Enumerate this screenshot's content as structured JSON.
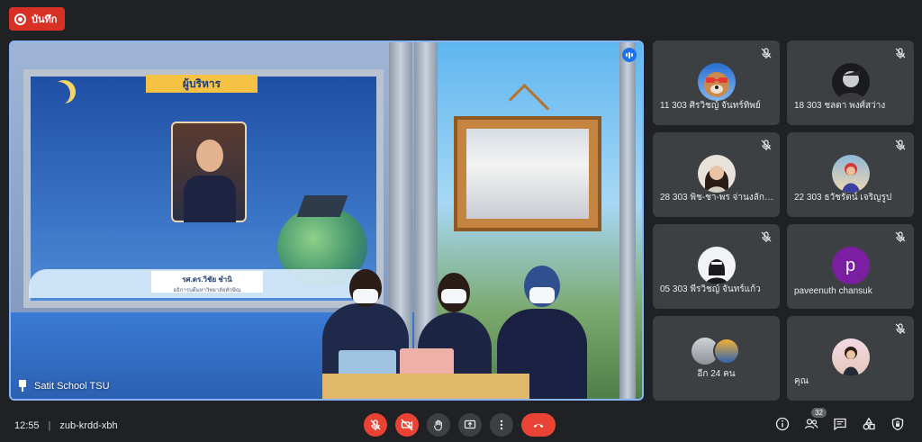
{
  "recording": {
    "label": "บันทึก"
  },
  "main_video": {
    "presenter_label": "Satit School TSU",
    "slide_banner": "ผู้บริหาร",
    "slide_name": "รศ.ดร.วิชัย ชำนิ",
    "slide_role": "อธิการบดีมหาวิทยาลัยทักษิณ"
  },
  "participants": [
    {
      "name": "11 303 ศิรวิชญ์ จันทร์ทิพย์",
      "avatar": "dog-sunglasses-avatar"
    },
    {
      "name": "18 303 ชลดา พงศ์สว่าง",
      "avatar": "character-avatar"
    },
    {
      "name": "28 303 พิช-ชา-พร จ่านงลักษ...",
      "avatar": "girl-photo-avatar"
    },
    {
      "name": "22 303 ธวัชรัตน์ เจริญรูป",
      "avatar": "person-photo-avatar"
    },
    {
      "name": "05 303 พีรวิชญ์ จันทร์แก้ว",
      "avatar": "masked-avatar"
    },
    {
      "name": "paveenuth chansuk",
      "avatar_letter": "p"
    },
    {
      "name": "อีก 24 คน",
      "avatar": "group-avatars"
    },
    {
      "name": "คุณ",
      "avatar": "self-photo-avatar"
    }
  ],
  "meeting": {
    "time": "12:55",
    "code": "zub-krdd-xbh"
  },
  "people_count": "32",
  "colors": {
    "background": "#202124",
    "tile": "#3c4043",
    "red": "#ea4335",
    "accent": "#8ab4f8"
  }
}
